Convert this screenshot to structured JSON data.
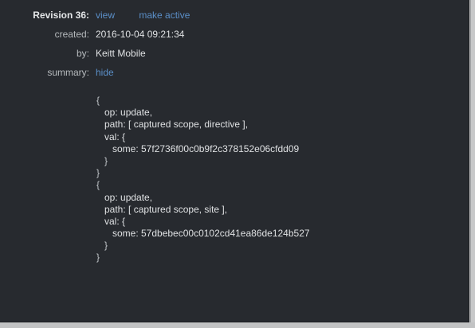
{
  "revision": {
    "label": "Revision 36:",
    "view_link": "view",
    "make_active_link": "make active"
  },
  "fields": {
    "created_label": "created:",
    "created_value": "2016-10-04 09:21:34",
    "by_label": "by:",
    "by_value": "Keitt Mobile",
    "summary_label": "summary:",
    "summary_toggle": "hide"
  },
  "summary": [
    {
      "open": "{",
      "op": "op: update,",
      "path": "path: [ captured scope, directive ],",
      "val_open": "val: {",
      "some": "some: 57f2736f00c0b9f2c378152e06cfdd09",
      "val_close": "}",
      "close": "}"
    },
    {
      "open": "{",
      "op": "op: update,",
      "path": "path: [ captured scope, site ],",
      "val_open": "val: {",
      "some": "some: 57dbebec00c0102cd41ea86de124b527",
      "val_close": "}",
      "close": "}"
    }
  ],
  "colors": {
    "panel_bg": "#272a2f",
    "link": "#5b8fc8",
    "text": "#e0e2e4"
  }
}
